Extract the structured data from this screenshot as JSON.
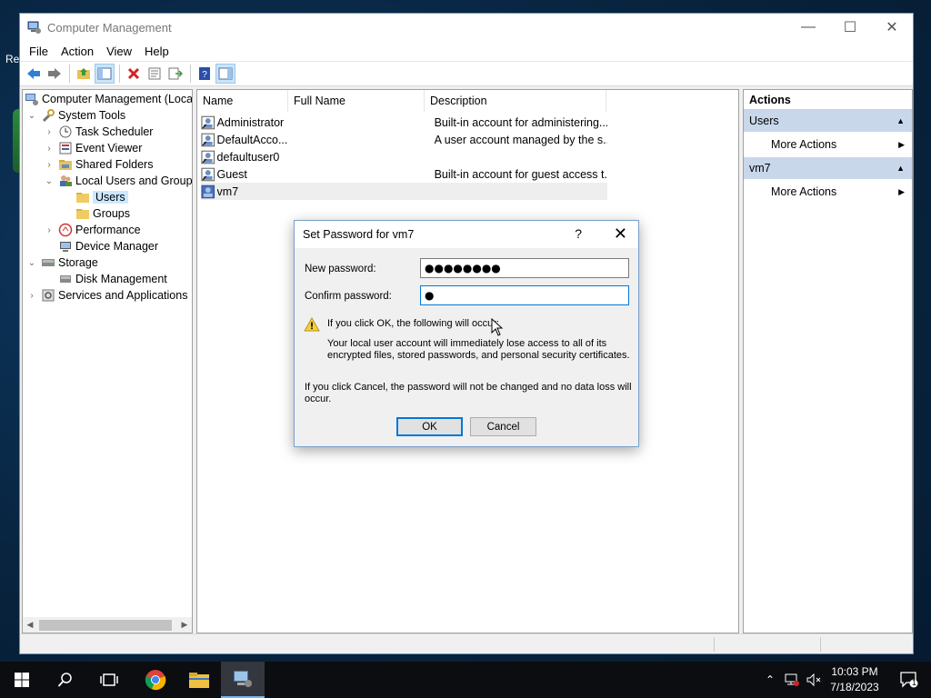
{
  "desktop": {
    "fragment_text": "Re"
  },
  "window": {
    "title": "Computer Management",
    "controls": {
      "minimize": "—",
      "maximize": "☐",
      "close": "✕"
    }
  },
  "menu": [
    "File",
    "Action",
    "View",
    "Help"
  ],
  "tree": [
    {
      "label": "Computer Management (Local",
      "level": 0,
      "arrow": "",
      "icon": "computer-management-icon"
    },
    {
      "label": "System Tools",
      "level": 1,
      "arrow": "⌄",
      "icon": "system-tools-icon"
    },
    {
      "label": "Task Scheduler",
      "level": 2,
      "arrow": "›",
      "icon": "task-scheduler-icon"
    },
    {
      "label": "Event Viewer",
      "level": 2,
      "arrow": "›",
      "icon": "event-viewer-icon"
    },
    {
      "label": "Shared Folders",
      "level": 2,
      "arrow": "›",
      "icon": "shared-folders-icon"
    },
    {
      "label": "Local Users and Groups",
      "level": 2,
      "arrow": "⌄",
      "icon": "local-users-groups-icon"
    },
    {
      "label": "Users",
      "level": 3,
      "arrow": "",
      "icon": "folder-icon",
      "selected": true
    },
    {
      "label": "Groups",
      "level": 3,
      "arrow": "",
      "icon": "folder-icon"
    },
    {
      "label": "Performance",
      "level": 2,
      "arrow": "›",
      "icon": "performance-icon"
    },
    {
      "label": "Device Manager",
      "level": 2,
      "arrow": "",
      "icon": "device-manager-icon"
    },
    {
      "label": "Storage",
      "level": 1,
      "arrow": "⌄",
      "icon": "storage-icon"
    },
    {
      "label": "Disk Management",
      "level": 2,
      "arrow": "",
      "icon": "disk-management-icon"
    },
    {
      "label": "Services and Applications",
      "level": 1,
      "arrow": "›",
      "icon": "services-icon"
    }
  ],
  "list": {
    "columns": [
      "Name",
      "Full Name",
      "Description"
    ],
    "rows": [
      {
        "name": "Administrator",
        "full_name": "",
        "description": "Built-in account for administering..."
      },
      {
        "name": "DefaultAcco...",
        "full_name": "",
        "description": "A user account managed by the s..."
      },
      {
        "name": "defaultuser0",
        "full_name": "",
        "description": ""
      },
      {
        "name": "Guest",
        "full_name": "",
        "description": "Built-in account for guest access t..."
      },
      {
        "name": "vm7",
        "full_name": "",
        "description": "",
        "selected": true
      }
    ]
  },
  "actions": {
    "header": "Actions",
    "groups": [
      {
        "title": "Users",
        "items": [
          "More Actions"
        ]
      },
      {
        "title": "vm7",
        "items": [
          "More Actions"
        ]
      }
    ]
  },
  "dialog": {
    "title": "Set Password for vm7",
    "help": "?",
    "close": "✕",
    "new_password_label": "New password:",
    "new_password_value": "●●●●●●●●",
    "confirm_password_label": "Confirm password:",
    "confirm_password_value": "●",
    "warning_heading": "If you click OK, the following will occur:",
    "warning_body_line1": "Your local user account will immediately lose access to all of its",
    "warning_body_line2": "encrypted files, stored passwords, and personal security certificates.",
    "cancel_note_line1": "If you click Cancel, the password will not be changed and no data loss will",
    "cancel_note_line2": "occur.",
    "ok_label": "OK",
    "cancel_label": "Cancel"
  },
  "taskbar": {
    "clock_time": "10:03 PM",
    "clock_date": "7/18/2023",
    "notification_count": "1"
  },
  "colors": {
    "selection": "#cce8ff",
    "actions_group": "#c8d7ea",
    "dialog_focus": "#0078d7",
    "taskbar": "#0c0d10"
  }
}
